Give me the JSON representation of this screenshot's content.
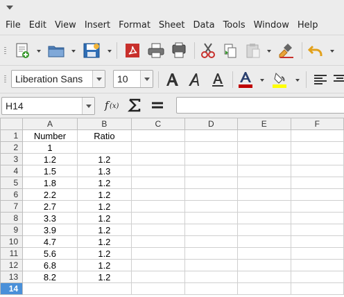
{
  "menu": [
    "File",
    "Edit",
    "View",
    "Insert",
    "Format",
    "Sheet",
    "Data",
    "Tools",
    "Window",
    "Help"
  ],
  "font": {
    "name": "Liberation Sans",
    "size": "10"
  },
  "name_box": "H14",
  "formula": {
    "value": ""
  },
  "columns": [
    "A",
    "B",
    "C",
    "D",
    "E",
    "F"
  ],
  "rows": [
    {
      "num": "1",
      "a": "Number",
      "b": "Ratio"
    },
    {
      "num": "2",
      "a": "1",
      "b": ""
    },
    {
      "num": "3",
      "a": "1.2",
      "b": "1.2"
    },
    {
      "num": "4",
      "a": "1.5",
      "b": "1.3"
    },
    {
      "num": "5",
      "a": "1.8",
      "b": "1.2"
    },
    {
      "num": "6",
      "a": "2.2",
      "b": "1.2"
    },
    {
      "num": "7",
      "a": "2.7",
      "b": "1.2"
    },
    {
      "num": "8",
      "a": "3.3",
      "b": "1.2"
    },
    {
      "num": "9",
      "a": "3.9",
      "b": "1.2"
    },
    {
      "num": "10",
      "a": "4.7",
      "b": "1.2"
    },
    {
      "num": "11",
      "a": "5.6",
      "b": "1.2"
    },
    {
      "num": "12",
      "a": "6.8",
      "b": "1.2"
    },
    {
      "num": "13",
      "a": "8.2",
      "b": "1.2"
    },
    {
      "num": "14",
      "a": "",
      "b": ""
    }
  ],
  "active_row": "14",
  "colors": {
    "font_color": "#c00000",
    "highlight": "#ffff00",
    "active_header": "#4a90d9"
  }
}
